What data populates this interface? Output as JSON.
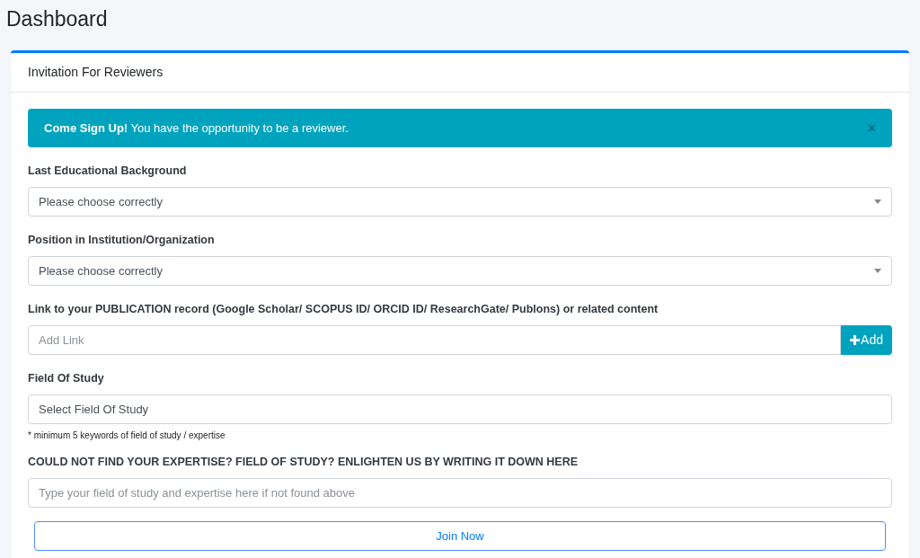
{
  "page_title": "Dashboard",
  "card": {
    "title": "Invitation For Reviewers",
    "alert": {
      "message": "**Come Sign Up!** You have the opportunity to be a reviewer.",
      "close": "×"
    },
    "fields": [
      {
        "kind": "select",
        "label": "Last Educational Background",
        "value": "Please choose correctly"
      },
      {
        "kind": "select",
        "label": "Position in Institution/Organization",
        "value": "Please choose correctly"
      },
      {
        "kind": "input_button",
        "label": "Link to your PUBLICATION record (Google Scholar/ SCOPUS ID/ ORCID ID/ ResearchGate/ Publons) or related content",
        "placeholder": "Add Link",
        "button": "Add"
      },
      {
        "kind": "tags",
        "label": "Field Of Study",
        "placeholder": "Select Field Of Study",
        "note": "* minimum 5 keywords of field of study / expertise"
      },
      {
        "kind": "input",
        "label": "COULD NOT FIND YOUR EXPERTISE? FIELD OF STUDY? ENLIGHTEN US BY WRITING IT DOWN HERE",
        "placeholder": "Type your field of study and expertise here if not found above"
      }
    ],
    "submit": "Join Now"
  }
}
